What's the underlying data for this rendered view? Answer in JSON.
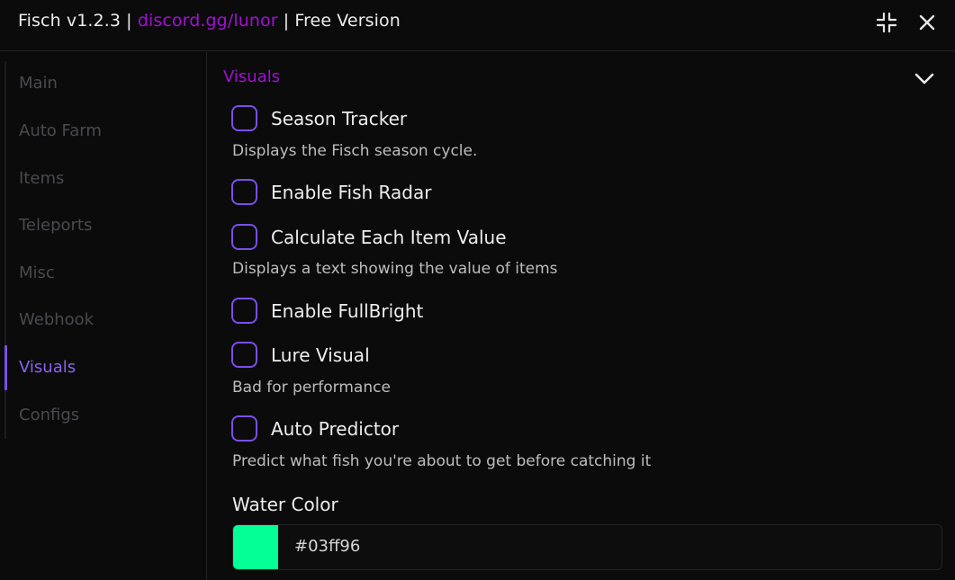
{
  "titlebar": {
    "title_prefix": "Fisch v1.2.3 | ",
    "title_link": "discord.gg/lunor",
    "title_suffix": " | Free Version",
    "minimize_icon": "collapse-arrows-icon",
    "close_icon": "close-icon"
  },
  "sidebar": {
    "items": [
      {
        "label": "Main"
      },
      {
        "label": "Auto Farm"
      },
      {
        "label": "Items"
      },
      {
        "label": "Teleports"
      },
      {
        "label": "Misc"
      },
      {
        "label": "Webhook"
      },
      {
        "label": "Visuals",
        "active": true
      },
      {
        "label": "Configs"
      }
    ]
  },
  "section": {
    "title": "Visuals",
    "collapse_icon": "chevron-down-icon",
    "toggles": [
      {
        "label": "Season Tracker",
        "checked": false,
        "description": "Displays the Fisch season cycle."
      },
      {
        "label": "Enable Fish Radar",
        "checked": false
      },
      {
        "label": "Calculate Each Item Value",
        "checked": false,
        "description": "Displays a text showing the value of items"
      },
      {
        "label": "Enable FullBright",
        "checked": false
      },
      {
        "label": "Lure Visual",
        "checked": false,
        "description": "Bad for performance"
      },
      {
        "label": "Auto Predictor",
        "checked": false,
        "description": "Predict what fish you're about to get before catching it"
      }
    ],
    "water_color": {
      "label": "Water Color",
      "value": "#03ff96"
    }
  },
  "colors": {
    "accent": "#7b4fe8",
    "link": "#a20fd6",
    "background": "#0b0b0c",
    "swatch": "#03ff96"
  }
}
